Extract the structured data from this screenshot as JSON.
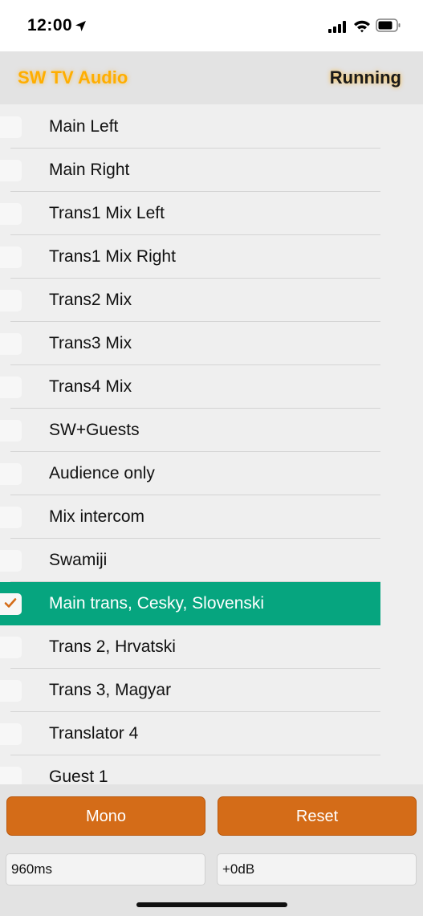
{
  "status_bar": {
    "time": "12:00"
  },
  "header": {
    "title": "SW TV Audio",
    "status": "Running"
  },
  "channels": [
    {
      "label": "Main Left",
      "checked": false
    },
    {
      "label": "Main Right",
      "checked": false
    },
    {
      "label": "Trans1 Mix Left",
      "checked": false
    },
    {
      "label": "Trans1 Mix Right",
      "checked": false
    },
    {
      "label": "Trans2 Mix",
      "checked": false
    },
    {
      "label": "Trans3 Mix",
      "checked": false
    },
    {
      "label": "Trans4 Mix",
      "checked": false
    },
    {
      "label": "SW+Guests",
      "checked": false
    },
    {
      "label": "Audience only",
      "checked": false
    },
    {
      "label": "Mix intercom",
      "checked": false
    },
    {
      "label": "Swamiji",
      "checked": false
    },
    {
      "label": "Main trans, Cesky, Slovenski",
      "checked": true
    },
    {
      "label": "Trans 2, Hrvatski",
      "checked": false
    },
    {
      "label": "Trans 3, Magyar",
      "checked": false
    },
    {
      "label": "Translator 4",
      "checked": false
    },
    {
      "label": "Guest 1",
      "checked": false
    }
  ],
  "controls": {
    "mono_label": "Mono",
    "reset_label": "Reset",
    "delay_value": "960ms",
    "gain_value": "+0dB"
  },
  "colors": {
    "accent": "#d46c18",
    "selected_row": "#06a57f",
    "title": "#ffae00"
  },
  "icons": [
    "location-arrow-icon",
    "cellular-signal-icon",
    "wifi-icon",
    "battery-icon",
    "checkmark-icon"
  ]
}
